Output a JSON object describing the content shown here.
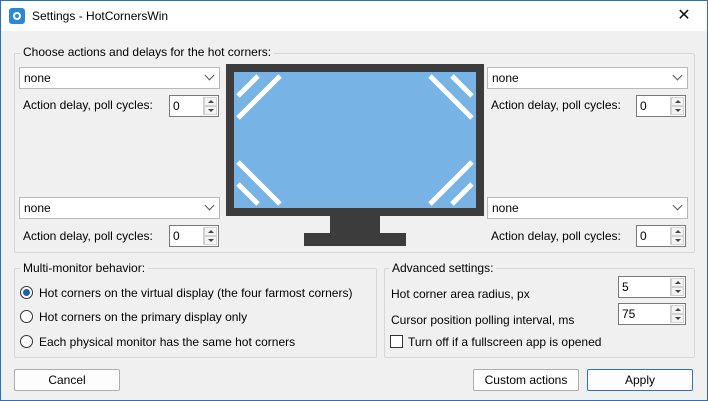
{
  "window": {
    "title": "Settings - HotCornersWin",
    "close_glyph": "✕",
    "accent_color": "#2b6fb5"
  },
  "corners_group": {
    "label": "Choose actions and delays for the hot corners:",
    "delay_label": "Action delay, poll cycles:",
    "top_left": {
      "action": "none",
      "delay": "0"
    },
    "top_right": {
      "action": "none",
      "delay": "0"
    },
    "bottom_left": {
      "action": "none",
      "delay": "0"
    },
    "bottom_right": {
      "action": "none",
      "delay": "0"
    },
    "monitor_colors": {
      "frame": "#3c3c3c",
      "screen": "#77b3e5",
      "marks": "#ffffff"
    }
  },
  "multi_monitor": {
    "label": "Multi-monitor behavior:",
    "options": [
      {
        "label": "Hot corners on the virtual display (the four farmost corners)",
        "checked": true
      },
      {
        "label": "Hot corners on the primary display only",
        "checked": false
      },
      {
        "label": "Each physical monitor has the same hot corners",
        "checked": false
      }
    ]
  },
  "advanced": {
    "label": "Advanced settings:",
    "radius_label": "Hot corner area radius, px",
    "radius_value": "5",
    "polling_label": "Cursor position polling interval, ms",
    "polling_value": "75",
    "fullscreen_label": "Turn off if a fullscreen app is opened",
    "fullscreen_checked": false
  },
  "buttons": {
    "cancel": "Cancel",
    "custom_actions": "Custom actions",
    "apply": "Apply"
  }
}
